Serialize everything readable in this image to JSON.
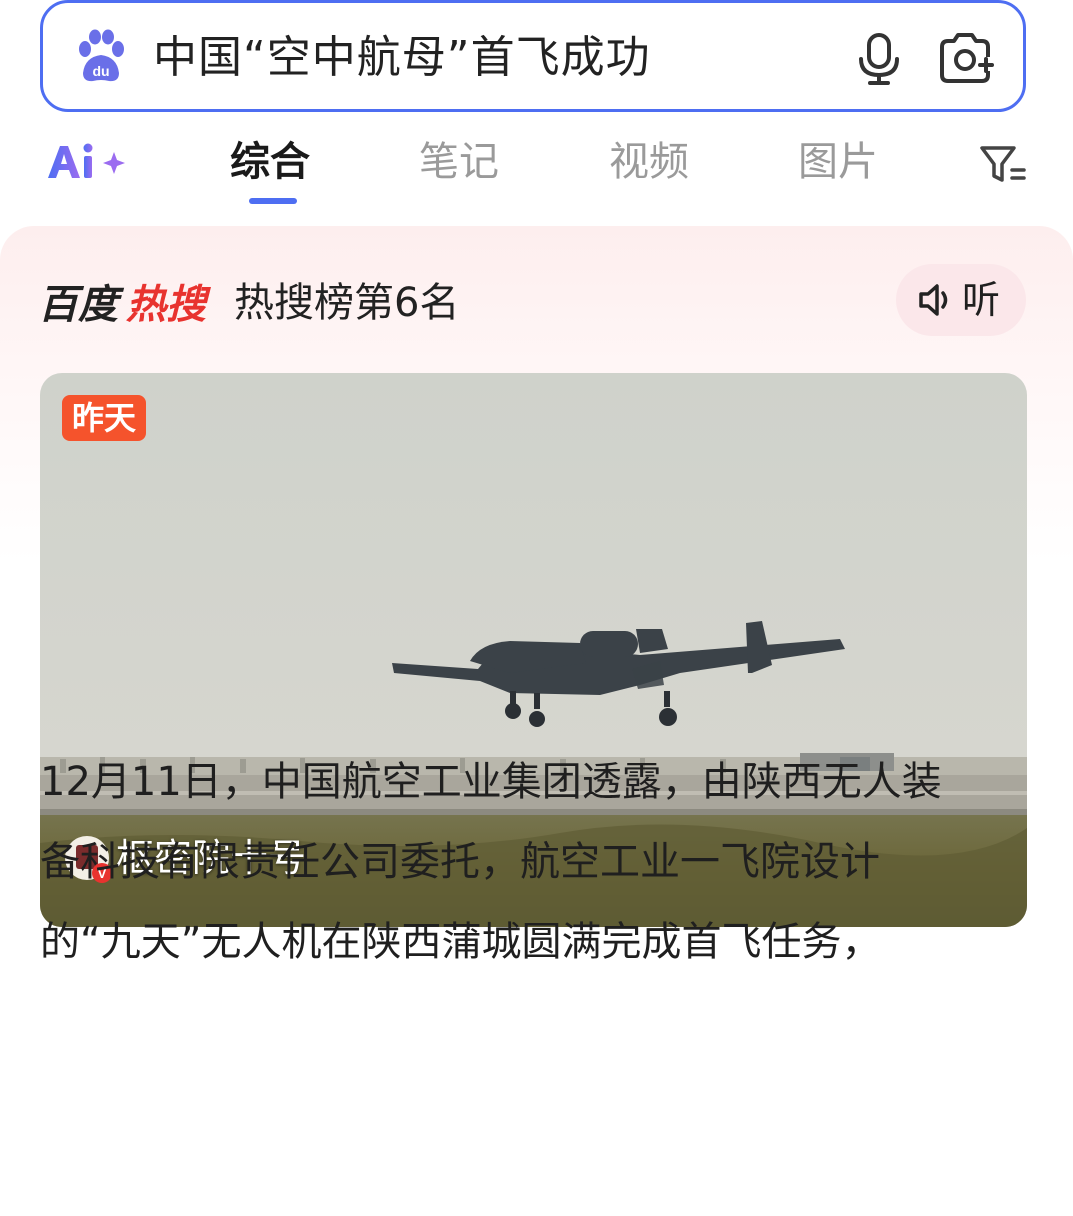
{
  "search": {
    "query": "中国“空中航母”首飞成功"
  },
  "tabs": {
    "items": [
      {
        "label": "综合",
        "active": true
      },
      {
        "label": "笔记",
        "active": false
      },
      {
        "label": "视频",
        "active": false
      },
      {
        "label": "图片",
        "active": false
      }
    ]
  },
  "hot": {
    "rank_text": "热搜榜第6名",
    "listen_label": "听"
  },
  "photo": {
    "time_badge": "昨天",
    "source_name": "枢密院十号"
  },
  "article": {
    "lines": [
      "12月11日，中国航空工业集团透露，由陕西无人装",
      "备科技有限责任公司委托，航空工业一飞院设计",
      "的“九天”无人机在陕西蒲城圆满完成首飞任务，"
    ]
  },
  "colors": {
    "accent": "#4e6ef2",
    "badge": "#f5532c",
    "hot_red": "#e8332f"
  }
}
